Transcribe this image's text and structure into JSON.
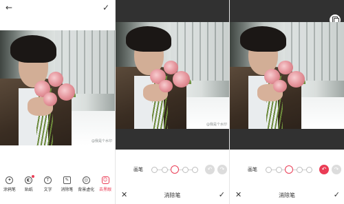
{
  "editor": {
    "back_icon": "back-arrow-icon",
    "confirm_icon": "check-icon",
    "tools": [
      {
        "label": "涂鸦笔",
        "icon": "magic-pen-icon"
      },
      {
        "label": "贴纸",
        "icon": "sticker-icon"
      },
      {
        "label": "文字",
        "icon": "text-icon"
      },
      {
        "label": "消除笔",
        "icon": "eraser-icon"
      },
      {
        "label": "背景虚化",
        "icon": "blur-icon"
      },
      {
        "label": "去黑眼",
        "icon": "face-icon"
      }
    ],
    "active_tool": "去黑眼"
  },
  "photo": {
    "watermark": "@我是个水印"
  },
  "eraser": {
    "brush_label": "画笔",
    "title": "消除笔",
    "close_icon": "close-icon",
    "check_icon": "check-icon",
    "undo_icon": "undo-icon",
    "redo_icon": "redo-icon",
    "compare_icon": "compare-icon",
    "brush_sizes": 5,
    "selected_size_index": 2,
    "panel2_undo_enabled": false,
    "panel3_undo_enabled": true
  },
  "colors": {
    "accent": "#ea3c55",
    "dark_background": "#313131"
  }
}
